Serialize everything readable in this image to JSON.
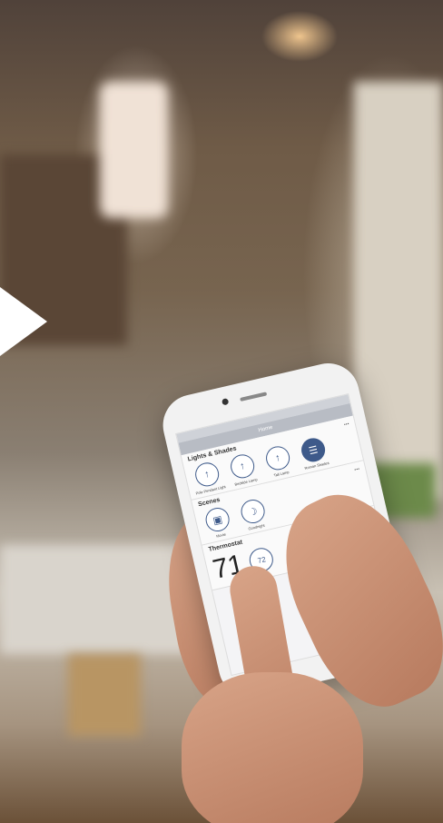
{
  "app": {
    "status": "",
    "title": "Home"
  },
  "lights_section": {
    "title": "Lights & Shades",
    "edit_label": "...",
    "items": [
      {
        "label": "Pole Pendant Light",
        "icon": "bulb-icon",
        "on": false
      },
      {
        "label": "Bedside Lamp",
        "icon": "bulb-icon",
        "on": false
      },
      {
        "label": "Tall Lamp",
        "icon": "bulb-icon",
        "on": false
      },
      {
        "label": "Roman Shades",
        "icon": "shade-icon",
        "on": true
      }
    ]
  },
  "scenes_section": {
    "title": "Scenes",
    "edit_label": "...",
    "items": [
      {
        "label": "Movie",
        "icon": "tv-icon"
      },
      {
        "label": "Goodnight",
        "icon": "moon-icon"
      }
    ]
  },
  "thermostat_section": {
    "title": "Thermostat",
    "edit_label": "...",
    "current_temp": "71",
    "setpoint": "72"
  },
  "colors": {
    "accent": "#3e5a8a",
    "arrow": "#ffffff"
  }
}
